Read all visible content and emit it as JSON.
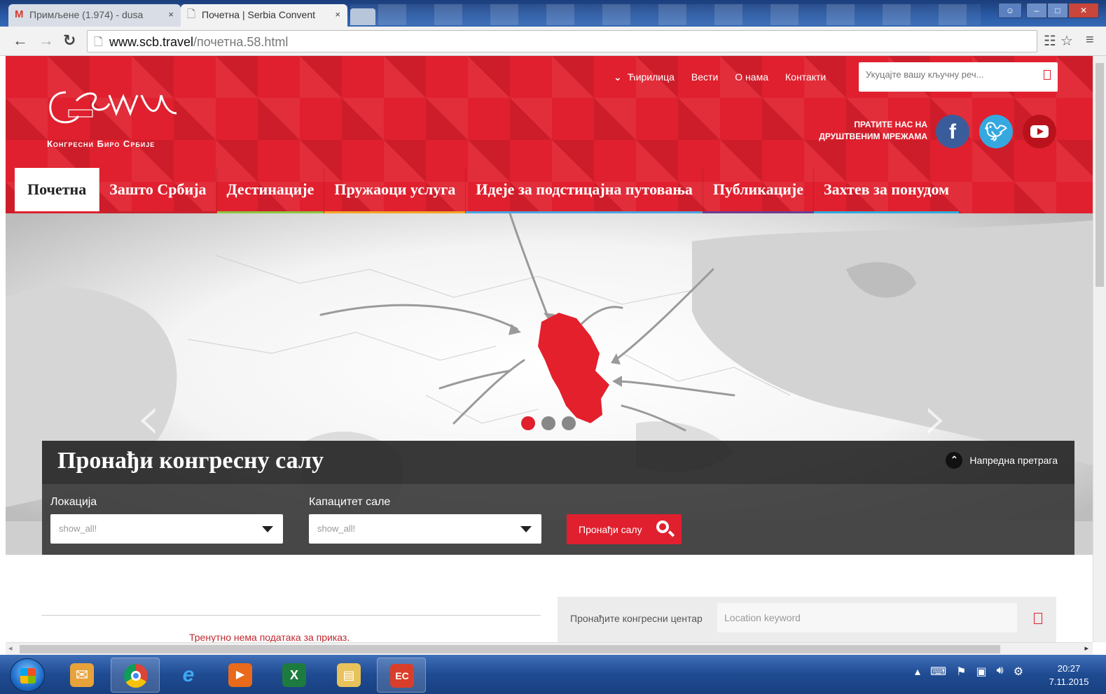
{
  "browser": {
    "tabs": [
      {
        "title": "Примљене (1.974) - dusa",
        "favicon": "gmail-icon",
        "active": false
      },
      {
        "title": "Почетна | Serbia Convent",
        "favicon": "document-icon",
        "active": true
      }
    ],
    "close_glyph": "×",
    "url_host": "www.scb.travel",
    "url_path": "/почетна.58.html"
  },
  "site": {
    "logo_text": "Србија",
    "logo_sub": "Конгресни Биро Србије",
    "topnav": [
      "Ћирилица",
      "Вести",
      "О нама",
      "Контакти"
    ],
    "search_placeholder": "Укуцајте вашу кључну реч...",
    "social_label_line1": "ПРАТИТЕ НАС НА",
    "social_label_line2": "ДРУШТВЕНИМ МРЕЖАМА",
    "social": [
      "facebook-icon",
      "twitter-icon",
      "youtube-icon"
    ],
    "mainnav": [
      {
        "label": "Почетна",
        "color": "#e0202e"
      },
      {
        "label": "Зашто Србија",
        "color": "#c9232d"
      },
      {
        "label": "Дестинације",
        "color": "#8cc63f"
      },
      {
        "label": "Пружаоци услуга",
        "color": "#f5a623"
      },
      {
        "label": "Идеје за подстицајна путовања",
        "color": "#4aa3df"
      },
      {
        "label": "Публикације",
        "color": "#6c3c91"
      },
      {
        "label": "Захтев за понудом",
        "color": "#2eaadc"
      }
    ],
    "accent": "#e0202e"
  },
  "hero": {
    "slides": 3,
    "active_slide": 1,
    "finder_title": "Пронађи конгресну салу",
    "advanced_label": "Напредна претрага",
    "location_label": "Локација",
    "location_value": "show_all!",
    "capacity_label": "Капацитет сале",
    "capacity_value": "show_all!",
    "find_button": "Пронађи салу"
  },
  "content": {
    "no_data": "Тренутно нема података за приказ.",
    "center_search_label": "Пронађите конгресни центар",
    "center_search_placeholder": "Location keyword"
  },
  "taskbar": {
    "apps": [
      "outlook-icon",
      "chrome-icon",
      "ie-icon",
      "media-player-icon",
      "excel-icon",
      "explorer-icon",
      "reader-icon"
    ],
    "time": "20:27",
    "date": "7.11.2015"
  }
}
